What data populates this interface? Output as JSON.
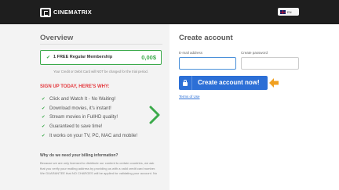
{
  "header": {
    "brand": "CINEMATRIX",
    "language": "EN"
  },
  "overview": {
    "title": "Overview",
    "plan": {
      "name": "1 FREE Regular Membership",
      "price": "0,00$"
    },
    "note": "Your Credit or Debit Card will NOT be charged for the trial period.",
    "signup_heading": "SIGN UP TODAY, HERE'S WHY:",
    "benefits": [
      "Click and Watch It - No Waiting!",
      "Download movies, it's instant!",
      "Stream movies in FullHD quality!",
      "Guaranteed to save time!",
      "It works on your TV, PC, MAC and mobile!"
    ],
    "billing_heading": "Why do we need your billing information?",
    "billing_text": "Because we are only licensed to distribute our content to certain countries, we ask that you verify your mailing address by providing us with a valid credit card number. We GUARANTEE that NO CHARGES will be applied for validating your account. No"
  },
  "create_account": {
    "title": "Create account",
    "email_label": "E-mail address",
    "email_value": "",
    "password_label": "Create password",
    "password_value": "",
    "button_label": "Create account now!",
    "terms_link": "Terms of Use"
  },
  "colors": {
    "accent_blue": "#2c6fd6",
    "accent_green": "#3caa4b",
    "alert_red": "#e4373c",
    "arrow_orange": "#f0a020"
  },
  "icons": {
    "logo": "cinematrix-logo-icon",
    "flag": "uk-flag-icon",
    "check": "check-icon",
    "chevron": "chevron-right-icon",
    "lock": "lock-icon",
    "arrow": "arrow-left-icon"
  }
}
